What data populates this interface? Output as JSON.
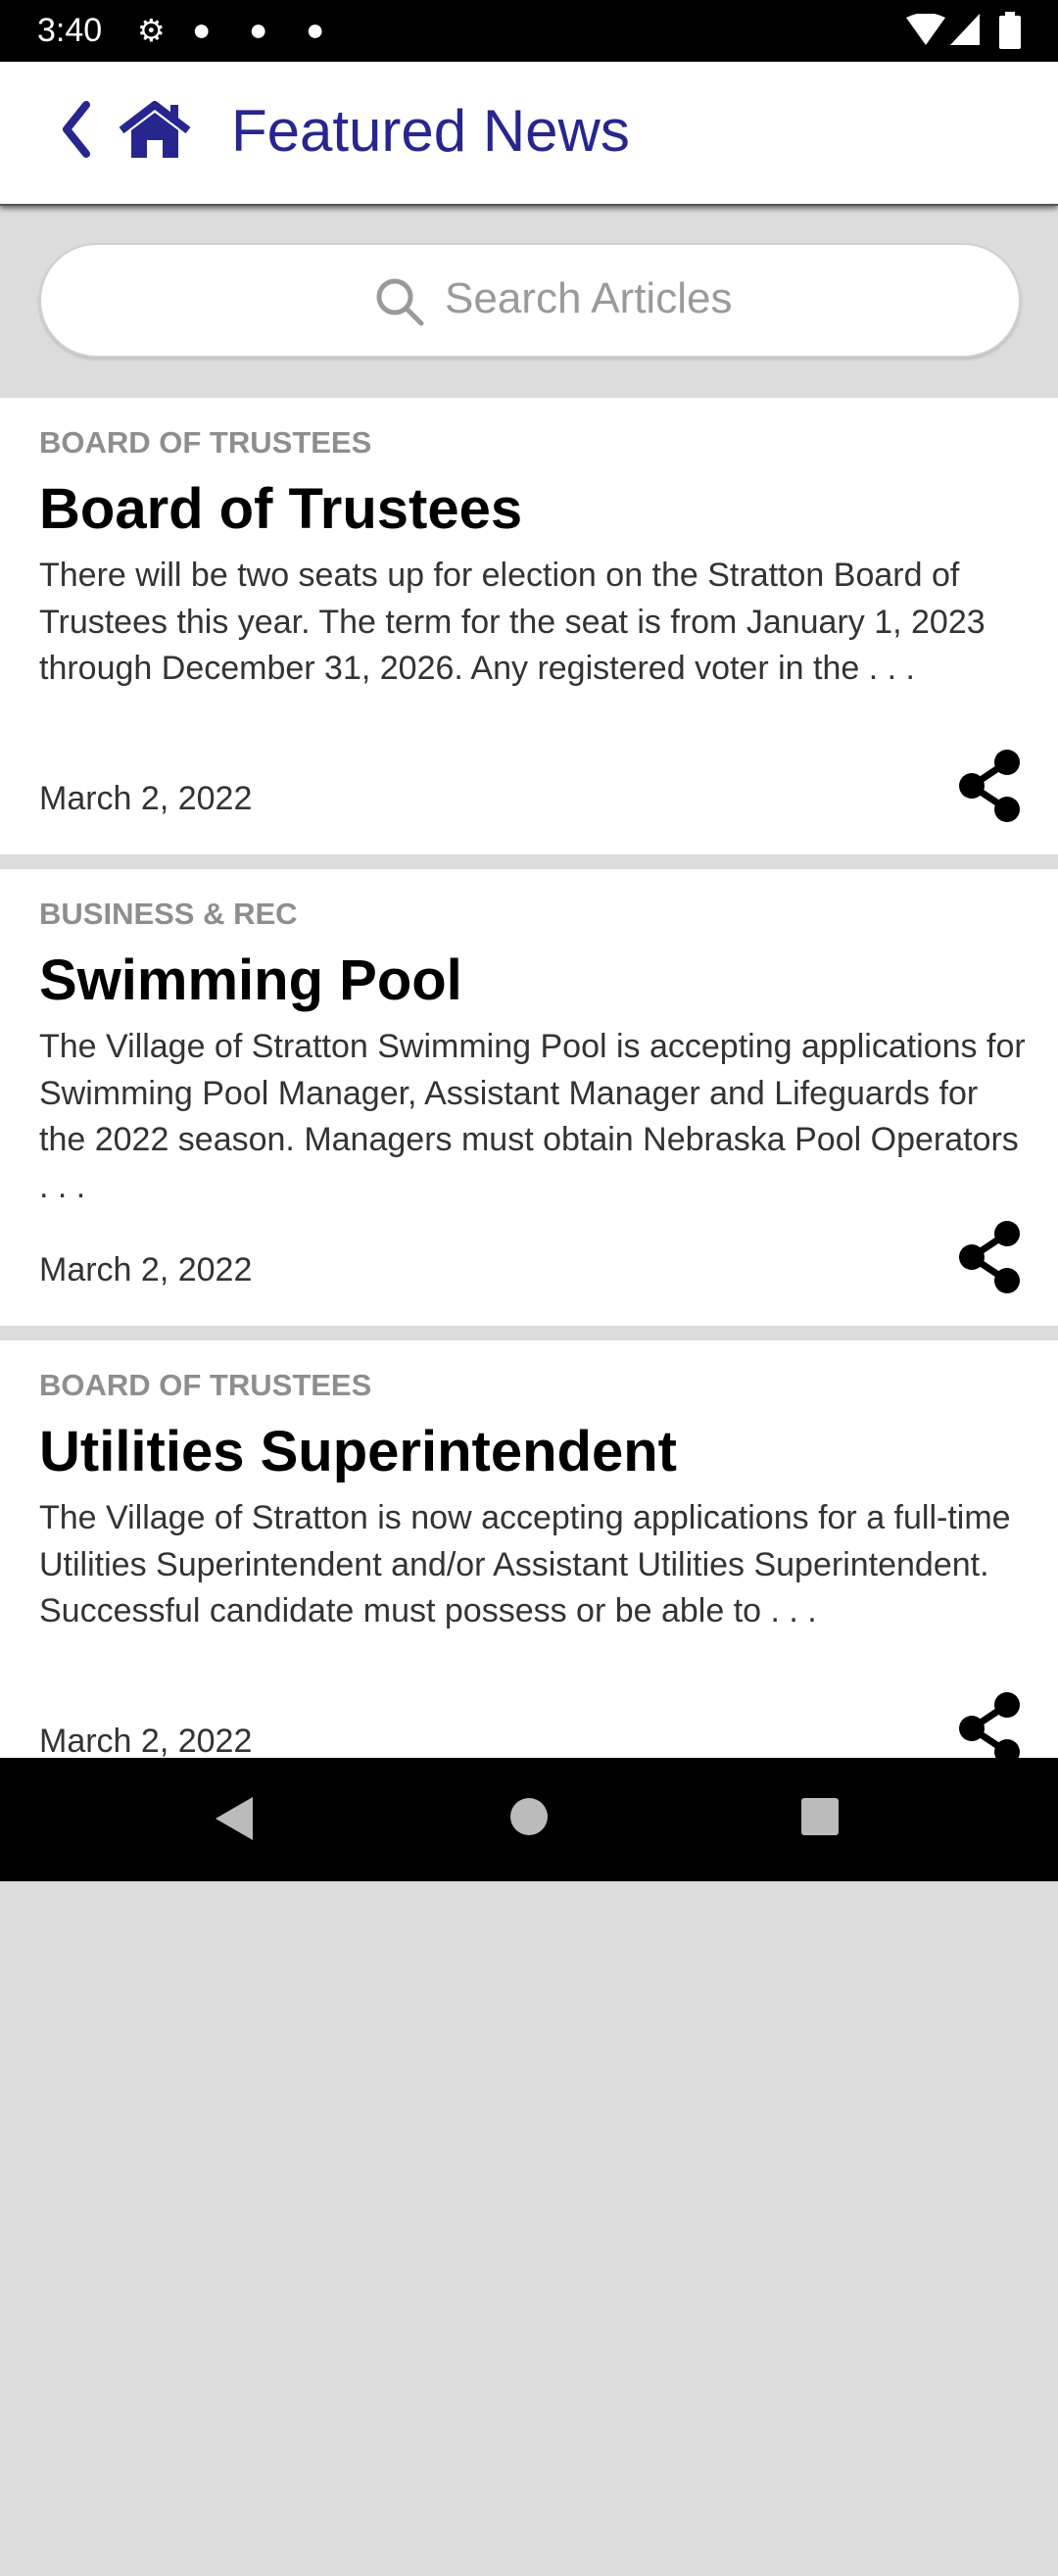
{
  "status_bar": {
    "time": "3:40",
    "icons": [
      "gear-icon",
      "sync-icon",
      "sync-icon",
      "sync-icon",
      "wifi-icon",
      "signal-icon",
      "battery-icon"
    ]
  },
  "header": {
    "title": "Featured News",
    "color": "#27268f"
  },
  "search": {
    "placeholder": "Search Articles"
  },
  "articles": [
    {
      "category": "BOARD OF TRUSTEES",
      "title": "Board of Trustees",
      "summary": "There will be two seats up for election on the Stratton Board of Trustees this year. The term for the seat is from January 1, 2023 through December 31, 2026. Any registered voter in the . . .",
      "date": "March 2, 2022"
    },
    {
      "category": "BUSINESS & REC",
      "title": "Swimming Pool",
      "summary": "The Village of Stratton Swimming Pool is accepting applications for Swimming Pool Manager, Assistant Manager and Lifeguards for the 2022 season. Managers must obtain Nebraska Pool Operators . . .",
      "date": "March 2, 2022"
    },
    {
      "category": "BOARD OF TRUSTEES",
      "title": "Utilities Superintendent",
      "summary": "The Village of Stratton is now accepting applications for a full-time Utilities Superintendent and/or Assistant Utilities Superintendent. Successful candidate must possess or be able to . . .",
      "date": "March 2, 2022"
    }
  ]
}
